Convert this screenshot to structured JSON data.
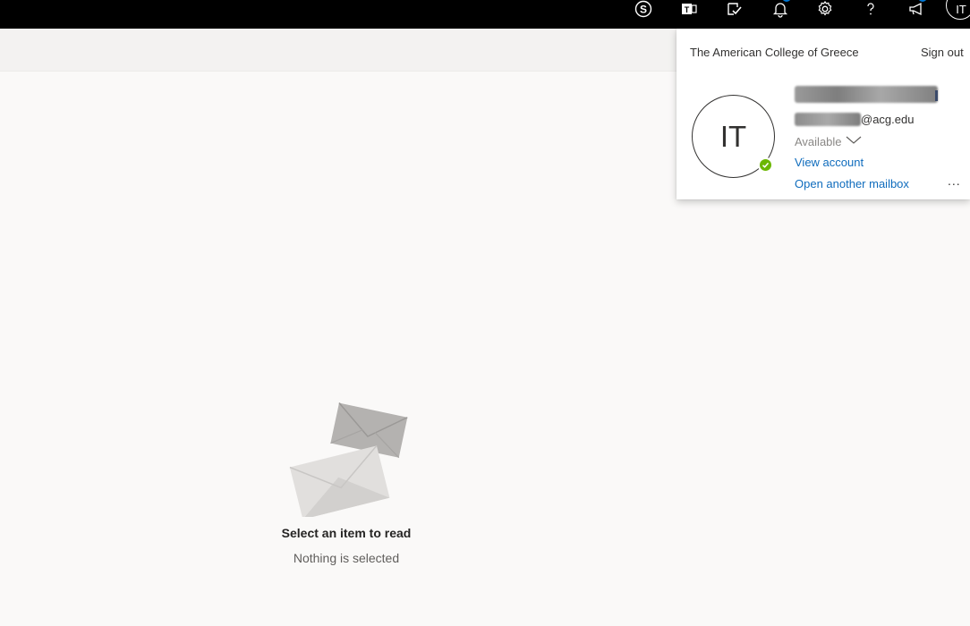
{
  "topbar": {
    "icons": [
      {
        "name": "skype-icon"
      },
      {
        "name": "teams-icon"
      },
      {
        "name": "todo-icon"
      },
      {
        "name": "notifications-icon"
      },
      {
        "name": "settings-icon"
      },
      {
        "name": "help-icon"
      },
      {
        "name": "feedback-icon"
      }
    ],
    "avatar_initials": "IT",
    "brand_color": "#000000",
    "badge_color": "#0078d4"
  },
  "account_panel": {
    "org_name": "The American College of Greece",
    "sign_out_label": "Sign out",
    "avatar_initials": "IT",
    "presence_color": "#6bb700",
    "email_domain": "@acg.edu",
    "presence_label": "Available",
    "view_account_label": "View account",
    "open_mailbox_label": "Open another mailbox",
    "more_label": "...",
    "link_color": "#0f6cbd"
  },
  "reading_pane": {
    "empty_title": "Select an item to read",
    "empty_subtitle": "Nothing is selected"
  }
}
